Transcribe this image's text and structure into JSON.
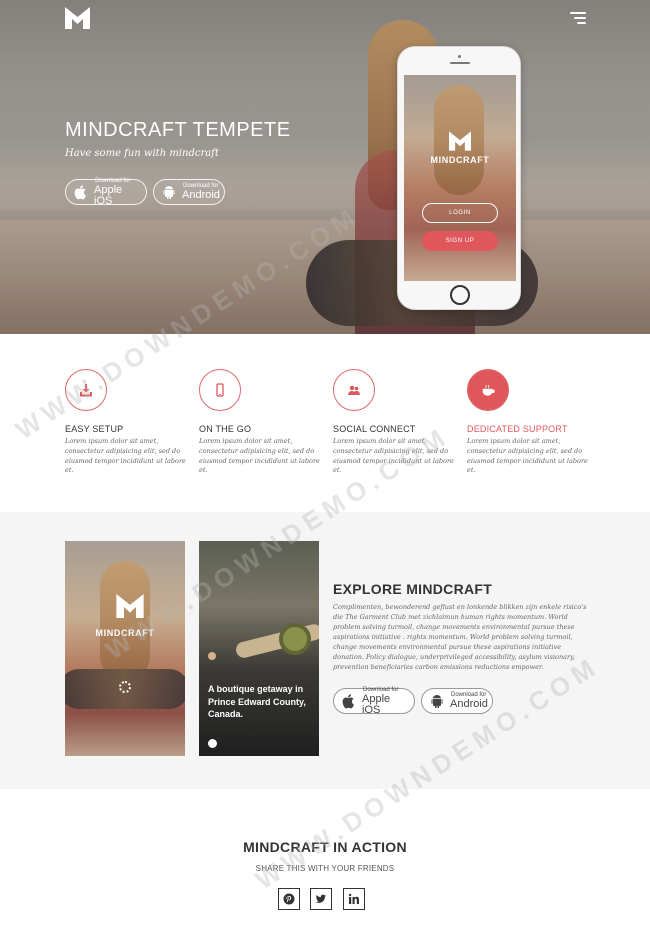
{
  "colors": {
    "accent": "#e0575b",
    "text": "#333333",
    "muted": "#666666",
    "section_bg": "#f5f5f5"
  },
  "header": {
    "logo_icon": "m-logo-icon",
    "menu_icon": "hamburger-menu-icon"
  },
  "hero": {
    "title": "MINDCRAFT TEMPETE",
    "subtitle": "Have some fun with mindcraft",
    "ios_button": {
      "small": "Download for",
      "big": "Apple iOS",
      "icon": "apple-icon"
    },
    "android_button": {
      "small": "Download for",
      "big": "Android",
      "icon": "android-icon"
    },
    "phone": {
      "brand": "MINDCRAFT",
      "login": "LOGIN",
      "signup": "SIGN UP"
    }
  },
  "features": [
    {
      "title": "EASY SETUP",
      "icon": "download-icon",
      "text": "Lorem ipsum dolor sit amet, consectetur adipisicing elit, sed do eiusmod tempor incididunt ut labore et."
    },
    {
      "title": "ON THE GO",
      "icon": "mobile-phone-icon",
      "text": "Lorem ipsum dolor sit amet, consectetur adipisicing elit, sed do eiusmod tempor incididunt ut labore et."
    },
    {
      "title": "SOCIAL CONNECT",
      "icon": "users-icon",
      "text": "Lorem ipsum dolor sit amet, consectetur adipisicing elit, sed do eiusmod tempor incididunt ut labore et."
    },
    {
      "title": "DEDICATED SUPPORT",
      "icon": "coffee-cup-icon",
      "text": "Lorem ipsum dolor sit amet, consectetur adipisicing elit, sed do eiusmod tempor incididunt ut labore et."
    }
  ],
  "explore": {
    "shot1_brand": "MINDCRAFT",
    "shot2": {
      "headline": "A boutique getaway in Prince Edward County, Canada."
    },
    "title": "EXPLORE MINDCRAFT",
    "text": "Complimenten, bewonderend geflust en lonkende blikken zijn enkele risico's die The Garment Club met zichlaimun human rights momentum. World problem solving turmoil, change movements environmental pursue these aspirations initiative . rights momentum. World problem solving turmoil, change movements environmental pursue these aspirations initiative donation. Policy dialogue, underprivileged accessibility, asylum visionary, prevention beneficiaries carbon emissions reductions empower.",
    "ios_button": {
      "small": "Download for",
      "big": "Apple iOS",
      "icon": "apple-icon"
    },
    "android_button": {
      "small": "Download for",
      "big": "Android",
      "icon": "android-icon"
    }
  },
  "action": {
    "title": "MINDCRAFT IN ACTION",
    "subtitle": "SHARE THIS WITH YOUR FRIENDS",
    "social": [
      "pinterest-icon",
      "twitter-icon",
      "linkedin-icon"
    ]
  },
  "watermark": "WWW.DOWNDEMO.COM"
}
